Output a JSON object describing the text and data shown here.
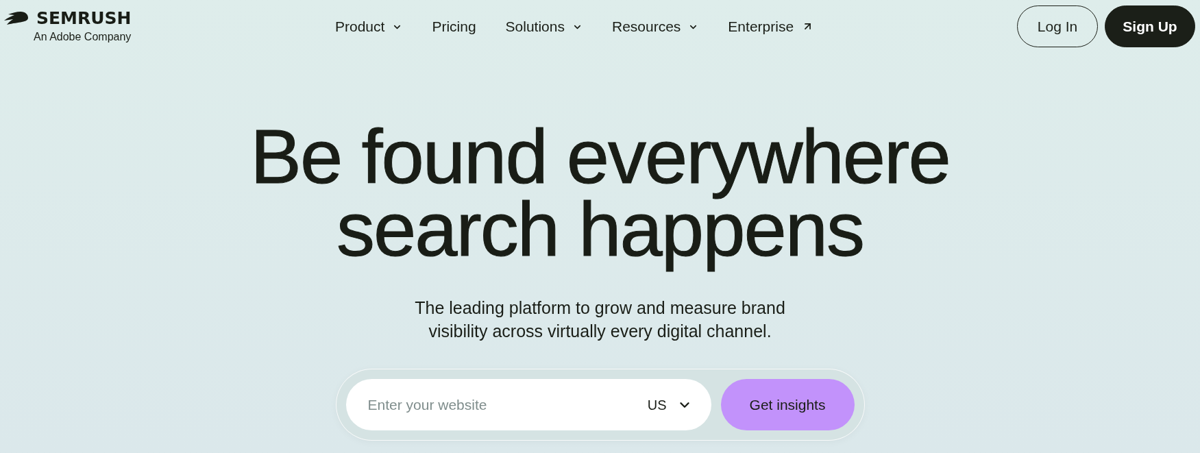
{
  "logo": {
    "wordmark": "SEMRUSH",
    "tagline": "An Adobe Company"
  },
  "nav": {
    "items": [
      {
        "label": "Product",
        "kind": "dropdown"
      },
      {
        "label": "Pricing",
        "kind": "link"
      },
      {
        "label": "Solutions",
        "kind": "dropdown"
      },
      {
        "label": "Resources",
        "kind": "dropdown"
      },
      {
        "label": "Enterprise",
        "kind": "external"
      }
    ]
  },
  "auth_buttons": [
    {
      "label": "Log In",
      "kind": "outline"
    },
    {
      "label": "Sign Up",
      "kind": "filled"
    }
  ],
  "hero": {
    "headline": "Be found everywhere search happens",
    "subtitle": "The leading platform to grow and measure brand visibility across virtually every digital channel.",
    "search": {
      "placeholder": "Enter your website",
      "country": "US",
      "button": "Get insights"
    }
  }
}
